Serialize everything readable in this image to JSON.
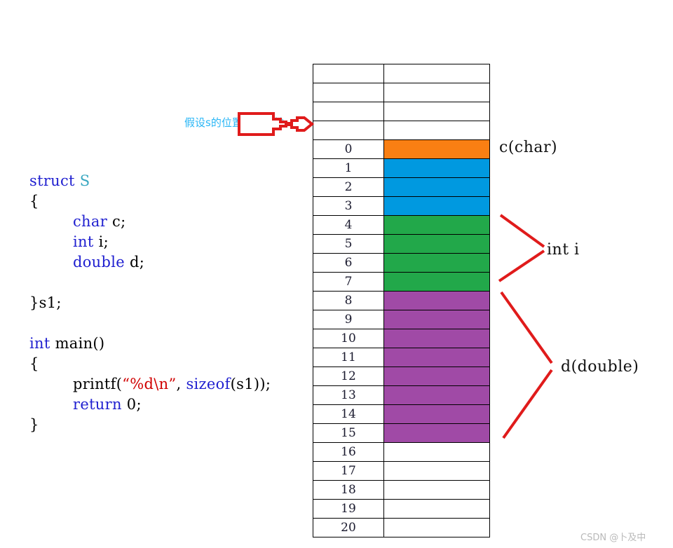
{
  "diagram": {
    "title_note_cn": "假设s的位置从此开始",
    "watermark": "CSDN @卜及中",
    "colors": {
      "char": "#f97f13",
      "padding": "#0099e0",
      "int": "#22a84a",
      "double": "#a04aa6",
      "empty": "#ffffff",
      "annotation_red": "#e01b1b",
      "note_blue": "#29b6f6",
      "keyword_blue": "#2020d0",
      "type_teal": "#3aa8c1",
      "string_red": "#d00000"
    }
  },
  "code": {
    "lines": [
      [
        {
          "t": "struct ",
          "c": "kw"
        },
        {
          "t": "S",
          "c": "typ"
        }
      ],
      [
        {
          "t": "{",
          "c": "pl"
        }
      ],
      [
        {
          "t": "    ",
          "c": "ind"
        },
        {
          "t": "char ",
          "c": "kw"
        },
        {
          "t": "c;",
          "c": "pl"
        }
      ],
      [
        {
          "t": "    ",
          "c": "ind"
        },
        {
          "t": "int ",
          "c": "kw"
        },
        {
          "t": "i;",
          "c": "pl"
        }
      ],
      [
        {
          "t": "    ",
          "c": "ind"
        },
        {
          "t": "double ",
          "c": "kw"
        },
        {
          "t": "d;",
          "c": "pl"
        }
      ],
      [],
      [
        {
          "t": "}s1;",
          "c": "pl"
        }
      ],
      [],
      [
        {
          "t": "int ",
          "c": "kw"
        },
        {
          "t": "main()",
          "c": "pl"
        }
      ],
      [
        {
          "t": "{",
          "c": "pl"
        }
      ],
      [
        {
          "t": "    ",
          "c": "ind"
        },
        {
          "t": "printf(",
          "c": "pl"
        },
        {
          "t": "“%d\\n”",
          "c": "str"
        },
        {
          "t": ", ",
          "c": "pl"
        },
        {
          "t": "sizeof",
          "c": "kw"
        },
        {
          "t": "(s1));",
          "c": "pl"
        }
      ],
      [
        {
          "t": "    ",
          "c": "ind"
        },
        {
          "t": "return ",
          "c": "kw"
        },
        {
          "t": "0;",
          "c": "pl"
        }
      ],
      [
        {
          "t": "}",
          "c": "pl"
        }
      ]
    ]
  },
  "memory_table": {
    "rows": [
      {
        "index": "",
        "fill": "empty"
      },
      {
        "index": "",
        "fill": "empty"
      },
      {
        "index": "",
        "fill": "empty"
      },
      {
        "index": "",
        "fill": "empty"
      },
      {
        "index": "0",
        "fill": "char"
      },
      {
        "index": "1",
        "fill": "padding"
      },
      {
        "index": "2",
        "fill": "padding"
      },
      {
        "index": "3",
        "fill": "padding"
      },
      {
        "index": "4",
        "fill": "int"
      },
      {
        "index": "5",
        "fill": "int"
      },
      {
        "index": "6",
        "fill": "int"
      },
      {
        "index": "7",
        "fill": "int"
      },
      {
        "index": "8",
        "fill": "double"
      },
      {
        "index": "9",
        "fill": "double"
      },
      {
        "index": "10",
        "fill": "double"
      },
      {
        "index": "11",
        "fill": "double"
      },
      {
        "index": "12",
        "fill": "double"
      },
      {
        "index": "13",
        "fill": "double"
      },
      {
        "index": "14",
        "fill": "double"
      },
      {
        "index": "15",
        "fill": "double"
      },
      {
        "index": "16",
        "fill": "empty"
      },
      {
        "index": "17",
        "fill": "empty"
      },
      {
        "index": "18",
        "fill": "empty"
      },
      {
        "index": "19",
        "fill": "empty"
      },
      {
        "index": "20",
        "fill": "empty"
      }
    ]
  },
  "labels": {
    "char": "c(char)",
    "int": "int i",
    "double": "d(double)"
  }
}
